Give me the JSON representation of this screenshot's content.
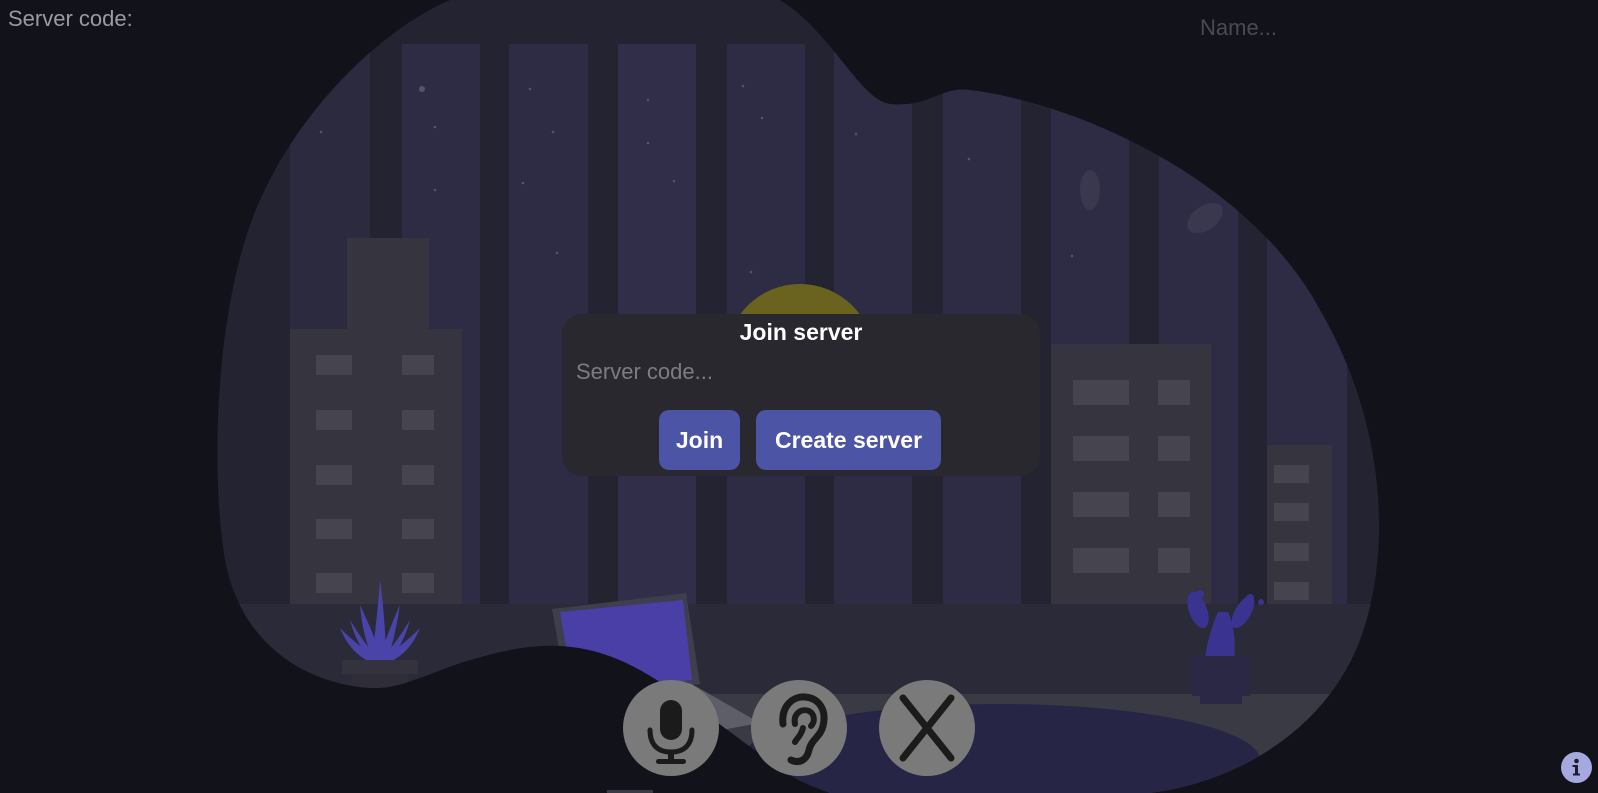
{
  "header": {
    "server_code_label": "Server code:",
    "name_placeholder": "Name..."
  },
  "dialog": {
    "title": "Join server",
    "server_code_placeholder": "Server code...",
    "join_label": "Join",
    "create_label": "Create server"
  },
  "controls": {
    "mic_icon": "microphone-icon",
    "ear_icon": "ear-icon",
    "close_icon": "close-icon",
    "info_icon": "info-icon"
  },
  "colors": {
    "background": "#12121a",
    "blob": "#2b2a3b",
    "dialog": "#28282e",
    "button": "#4b54a5",
    "plant": "#4a44a8",
    "moon": "#6a6320",
    "control": "#7a7a7a",
    "info": "#a6a8e0"
  }
}
